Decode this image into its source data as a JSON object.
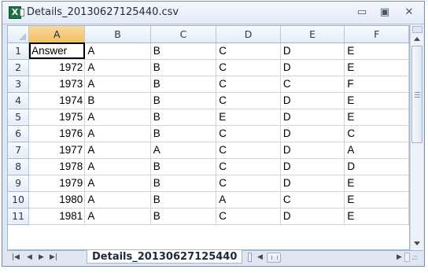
{
  "window": {
    "title": "Details_20130627125440.csv",
    "minimize_icon": "minimize-icon",
    "maximize_icon": "maximize-icon",
    "close_icon": "close-icon"
  },
  "grid": {
    "columns": [
      "A",
      "B",
      "C",
      "D",
      "E",
      "F"
    ],
    "selected_column": "A",
    "rows": [
      {
        "num": "1",
        "cells": [
          "Answer",
          "A",
          "B",
          "C",
          "D",
          "E"
        ]
      },
      {
        "num": "2",
        "cells": [
          "1972",
          "A",
          "B",
          "C",
          "D",
          "E"
        ]
      },
      {
        "num": "3",
        "cells": [
          "1973",
          "A",
          "B",
          "C",
          "C",
          "F"
        ]
      },
      {
        "num": "4",
        "cells": [
          "1974",
          "B",
          "B",
          "C",
          "D",
          "E"
        ]
      },
      {
        "num": "5",
        "cells": [
          "1975",
          "A",
          "B",
          "E",
          "D",
          "E"
        ]
      },
      {
        "num": "6",
        "cells": [
          "1976",
          "A",
          "B",
          "C",
          "D",
          "C"
        ]
      },
      {
        "num": "7",
        "cells": [
          "1977",
          "A",
          "A",
          "C",
          "D",
          "A"
        ]
      },
      {
        "num": "8",
        "cells": [
          "1978",
          "A",
          "B",
          "C",
          "D",
          "D"
        ]
      },
      {
        "num": "9",
        "cells": [
          "1979",
          "A",
          "B",
          "C",
          "D",
          "E"
        ]
      },
      {
        "num": "10",
        "cells": [
          "1980",
          "A",
          "B",
          "A",
          "C",
          "E"
        ]
      },
      {
        "num": "11",
        "cells": [
          "1981",
          "A",
          "B",
          "C",
          "D",
          "E"
        ]
      }
    ],
    "active_cell": "A1"
  },
  "tabs": {
    "nav_first": "|◀",
    "nav_prev": "◀",
    "nav_next": "▶",
    "nav_last": "▶|",
    "sheet_name": "Details_20130627125440",
    "scroll_left": "◀",
    "scroll_right": "▶",
    "size_grip": ".::"
  }
}
